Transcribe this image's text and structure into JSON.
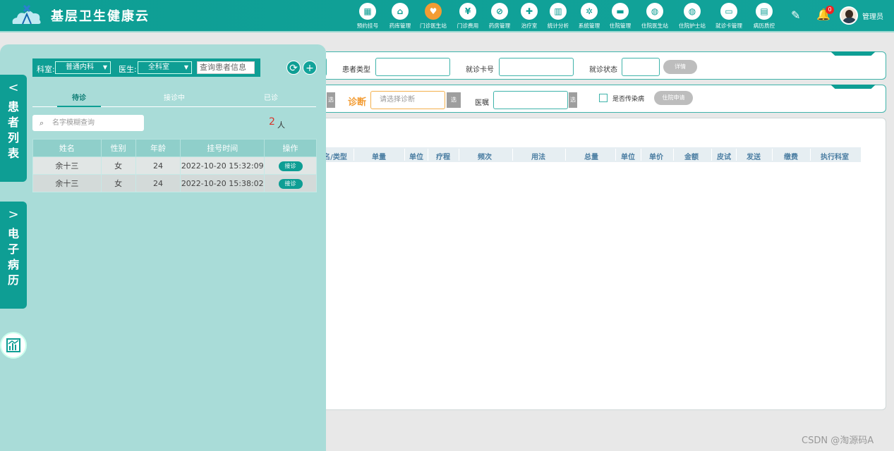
{
  "app": {
    "title": "基层卫生健康云"
  },
  "nav": [
    {
      "label": "预约挂号",
      "icon": "calendar-icon",
      "glyph": "▦"
    },
    {
      "label": "药库管理",
      "icon": "home-icon",
      "glyph": "⌂"
    },
    {
      "label": "门诊医生站",
      "icon": "doctor-icon",
      "glyph": "♥"
    },
    {
      "label": "门诊费用",
      "icon": "yuan-icon",
      "glyph": "¥"
    },
    {
      "label": "药房管理",
      "icon": "pill-icon",
      "glyph": "⊘"
    },
    {
      "label": "治疗室",
      "icon": "nurse-icon",
      "glyph": "✚"
    },
    {
      "label": "统计分析",
      "icon": "bar-chart-icon",
      "glyph": "▥"
    },
    {
      "label": "系统管理",
      "icon": "gear-icon",
      "glyph": "✲"
    },
    {
      "label": "住院管理",
      "icon": "bed-icon",
      "glyph": "▬"
    },
    {
      "label": "住院医生站",
      "icon": "doctor-card-icon",
      "glyph": "◍"
    },
    {
      "label": "住院护士站",
      "icon": "nurse-card-icon",
      "glyph": "◍"
    },
    {
      "label": "就诊卡管理",
      "icon": "card-icon",
      "glyph": "▭"
    },
    {
      "label": "病历质控",
      "icon": "record-icon",
      "glyph": "▤"
    }
  ],
  "user": {
    "name": "管理员",
    "notifications": "0"
  },
  "side_tabs": {
    "patient_list": [
      "患",
      "者",
      "列",
      "表"
    ],
    "emr": [
      "电",
      "子",
      "病",
      "历"
    ]
  },
  "filter": {
    "dept_label": "科室:",
    "dept_value": "普通内科",
    "doctor_label": "医生:",
    "doctor_value": "全科室",
    "search_placeholder": "查询患者信息"
  },
  "patient_tabs": [
    "待诊",
    "接诊中",
    "已诊"
  ],
  "name_search_placeholder": "名字模糊查询",
  "count": {
    "value": "2",
    "unit": "人"
  },
  "patient_table": {
    "headers": [
      "姓名",
      "性别",
      "年龄",
      "挂号时间",
      "操作"
    ],
    "rows": [
      {
        "name": "余十三",
        "gender": "女",
        "age": "24",
        "time": "2022-10-20 15:32:09",
        "action": "接诊"
      },
      {
        "name": "余十三",
        "gender": "女",
        "age": "24",
        "time": "2022-10-20 15:38:02",
        "action": "接诊"
      }
    ]
  },
  "form": {
    "patient_type_label": "患者类型",
    "card_no_label": "就诊卡号",
    "visit_status_label": "就诊状态",
    "detail_btn": "详情",
    "select_btn": "选",
    "diagnosis_label": "诊断",
    "diagnosis_placeholder": "请选择诊断",
    "advice_label": "医嘱",
    "infectious_label": "是否传染病",
    "admission_btn": "住院申请"
  },
  "order_columns": [
    "名/类型",
    "单量",
    "单位",
    "疗程",
    "频次",
    "用法",
    "总量",
    "单位",
    "单价",
    "金额",
    "皮试",
    "发送",
    "缴费",
    "执行科室"
  ],
  "watermark": "CSDN @淘源码A"
}
